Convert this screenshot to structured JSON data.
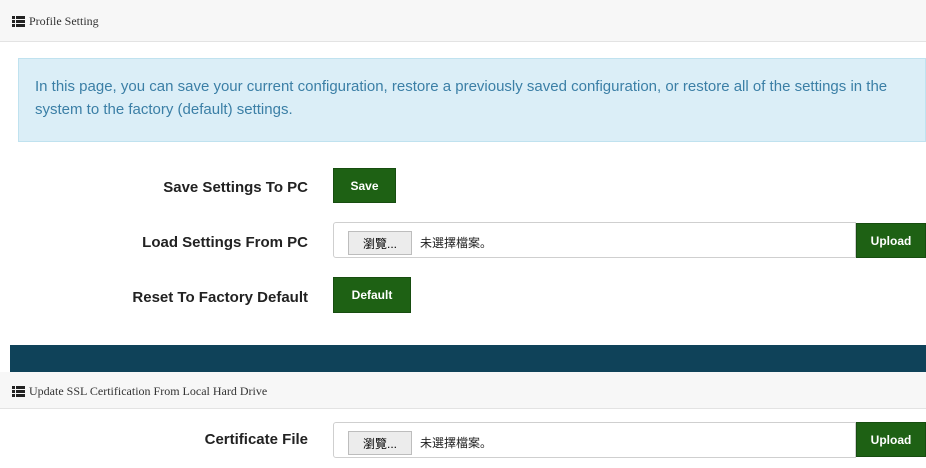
{
  "profile_panel": {
    "title": "Profile Setting",
    "info_text": "In this page, you can save your current configuration, restore a previously saved configuration, or restore all of the settings in the system to the factory (default) settings.",
    "rows": {
      "save": {
        "label": "Save Settings To PC",
        "button": "Save"
      },
      "load": {
        "label": "Load Settings From PC",
        "browse": "瀏覽...",
        "no_file": "未選擇檔案。",
        "button": "Upload"
      },
      "reset": {
        "label": "Reset To Factory Default",
        "button": "Default"
      }
    }
  },
  "ssl_panel": {
    "title": "Update SSL Certification From Local Hard Drive",
    "certificate": {
      "label": "Certificate File",
      "browse": "瀏覽...",
      "no_file": "未選擇檔案。",
      "button": "Upload"
    }
  },
  "colors": {
    "button_green": "#1e6114",
    "info_bg": "#dbeef7",
    "info_text": "#3b7fa6",
    "band": "#0f4259"
  }
}
